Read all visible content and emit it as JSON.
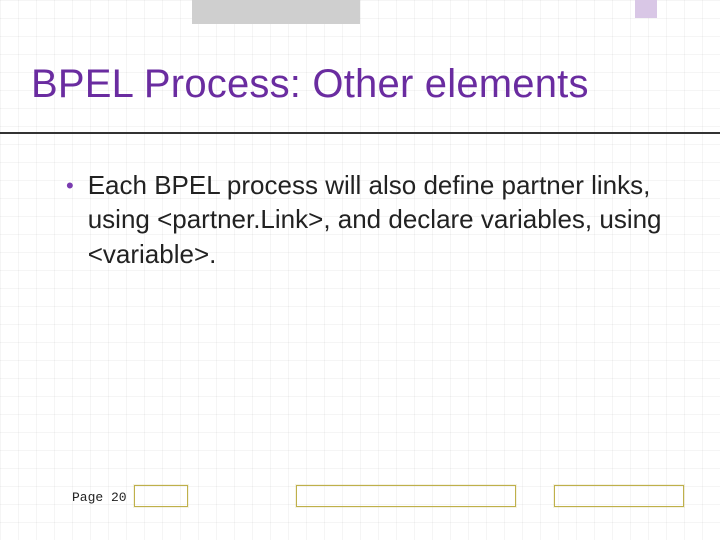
{
  "title": "BPEL Process: Other elements",
  "bullets": [
    "Each BPEL process will also define partner links, using <partner.Link>, and declare variables, using <variable>."
  ],
  "page_label": "Page 20"
}
